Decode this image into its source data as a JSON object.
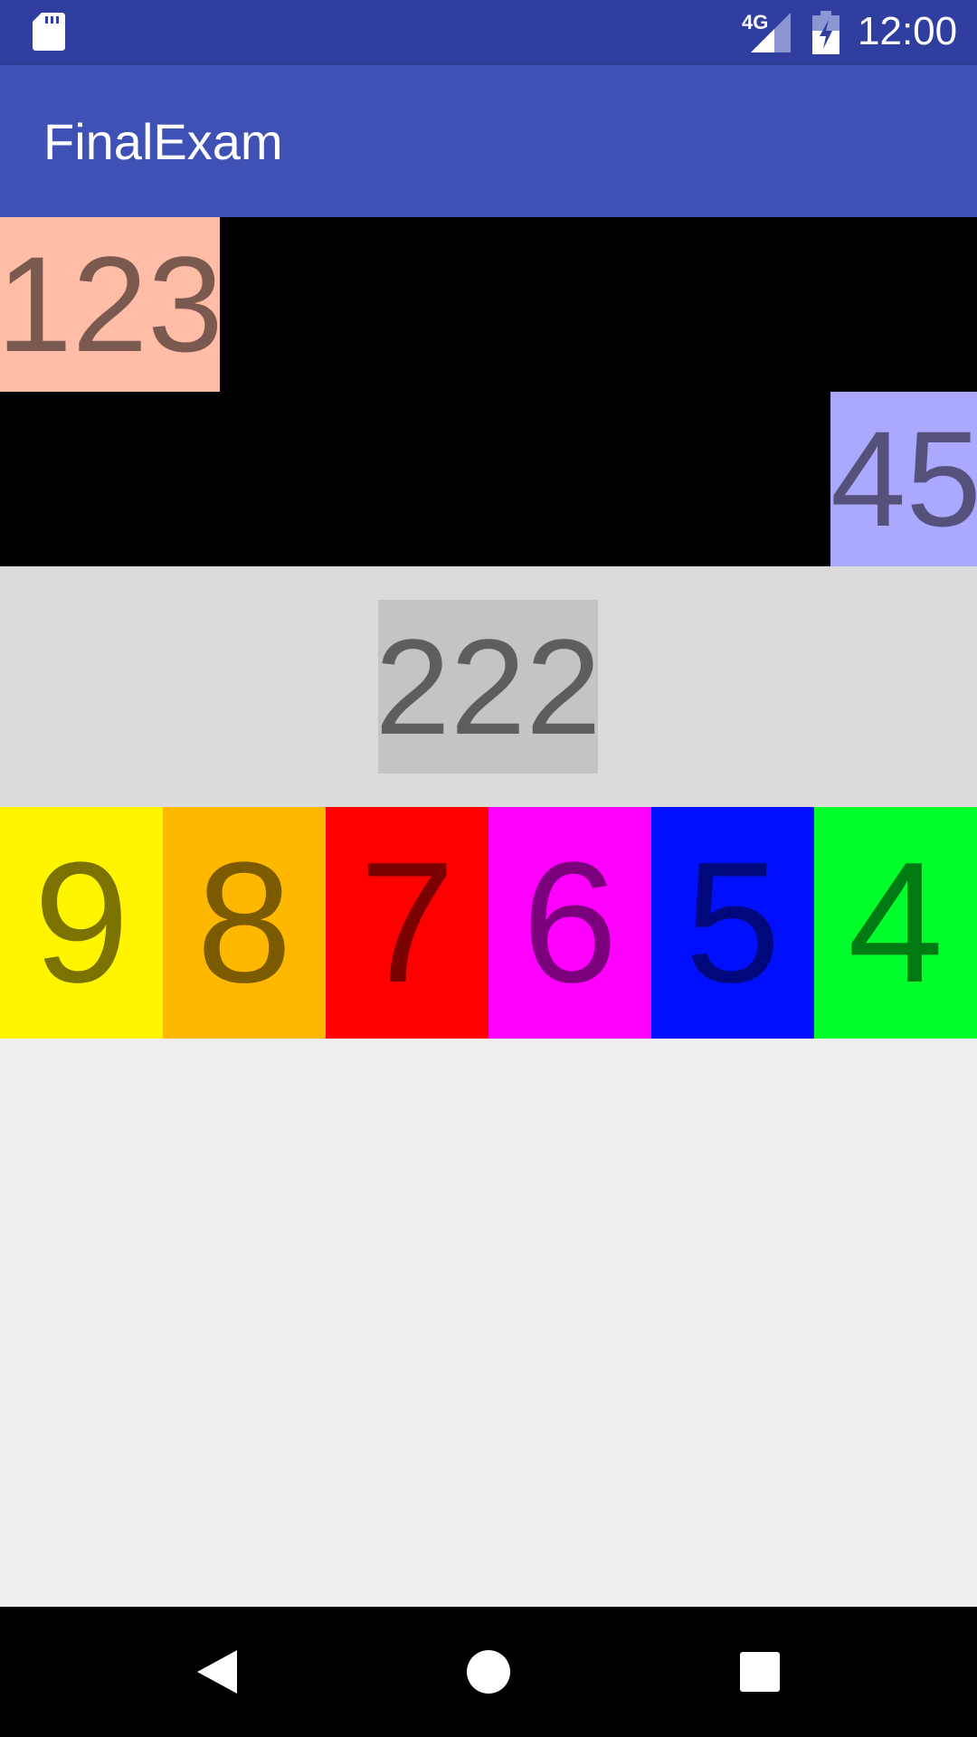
{
  "status_bar": {
    "network": "4G",
    "time": "12:00",
    "icons": [
      "sd-card-icon",
      "signal-icon",
      "battery-charging-icon"
    ]
  },
  "app_bar": {
    "title": "FinalExam"
  },
  "boxes": {
    "top_left": {
      "text": "123",
      "bg": "#FFBCA6",
      "fg": "#7A5A4F"
    },
    "right": {
      "text": "45",
      "bg": "#AAA8FF",
      "fg": "#54527B"
    },
    "center": {
      "text": "222",
      "bg": "#C4C4C4",
      "fg": "#5E5E5E"
    }
  },
  "colors": {
    "status_bar": "#303F9F",
    "app_bar": "#3F51B5",
    "black_section": "#000000",
    "grey_section": "#DBDBDB",
    "background": "#EEEEEE"
  },
  "color_row": [
    {
      "text": "9",
      "bg": "#FFF500",
      "fg": "#7B7200"
    },
    {
      "text": "8",
      "bg": "#FFB800",
      "fg": "#7B5A00"
    },
    {
      "text": "7",
      "bg": "#FF0000",
      "fg": "#7B0000"
    },
    {
      "text": "6",
      "bg": "#FF00FF",
      "fg": "#7B007B"
    },
    {
      "text": "5",
      "bg": "#0010FF",
      "fg": "#00087B"
    },
    {
      "text": "4",
      "bg": "#00FF2A",
      "fg": "#007B14"
    }
  ],
  "nav_bar": {
    "buttons": [
      "back-icon",
      "home-icon",
      "recent-apps-icon"
    ]
  }
}
